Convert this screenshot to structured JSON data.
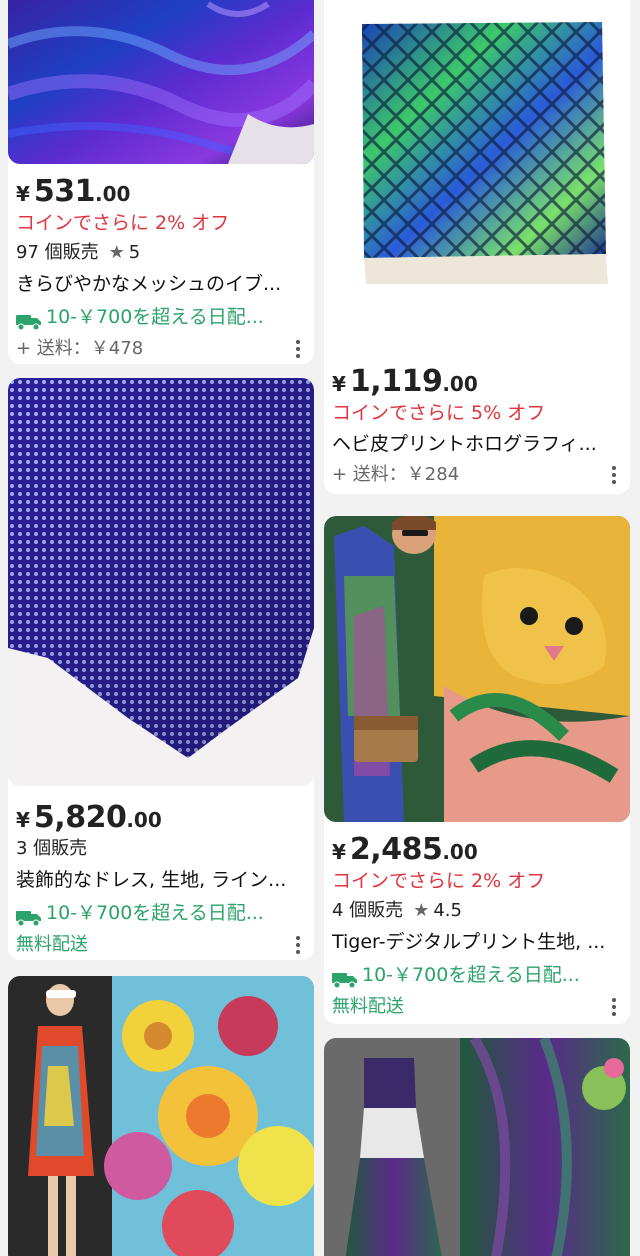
{
  "products": [
    {
      "id": "p1",
      "price_symbol": "¥",
      "price_int": "531",
      "price_dec": ".00",
      "coin_offer": "コインでさらに 2% オフ",
      "sold": "97 個販売",
      "rating": "5",
      "title": "きらびやかなメッシュのイブ...",
      "promo": "10-￥700を超える日配...",
      "shipping": "+ 送料：￥478"
    },
    {
      "id": "p2",
      "price_symbol": "¥",
      "price_int": "1,119",
      "price_dec": ".00",
      "coin_offer": "コインでさらに 5% オフ",
      "title": "ヘビ皮プリントホログラフィ...",
      "shipping": "+ 送料：￥284"
    },
    {
      "id": "p3",
      "price_symbol": "¥",
      "price_int": "5,820",
      "price_dec": ".00",
      "sold": "3 個販売",
      "title": "装飾的なドレス, 生地, ライン...",
      "promo": "10-￥700を超える日配...",
      "shipping": "無料配送"
    },
    {
      "id": "p4",
      "price_symbol": "¥",
      "price_int": "2,485",
      "price_dec": ".00",
      "coin_offer": "コインでさらに 2% オフ",
      "sold": "4 個販売",
      "rating": "4.5",
      "title": "Tiger-デジタルプリント生地, ...",
      "promo": "10-￥700を超える日配...",
      "shipping": "無料配送"
    }
  ],
  "icons": {
    "star": "star-icon",
    "truck": "truck-icon",
    "more": "more-vertical-icon"
  },
  "colors": {
    "accent_red": "#e0343e",
    "promo_green": "#2ca36b"
  }
}
